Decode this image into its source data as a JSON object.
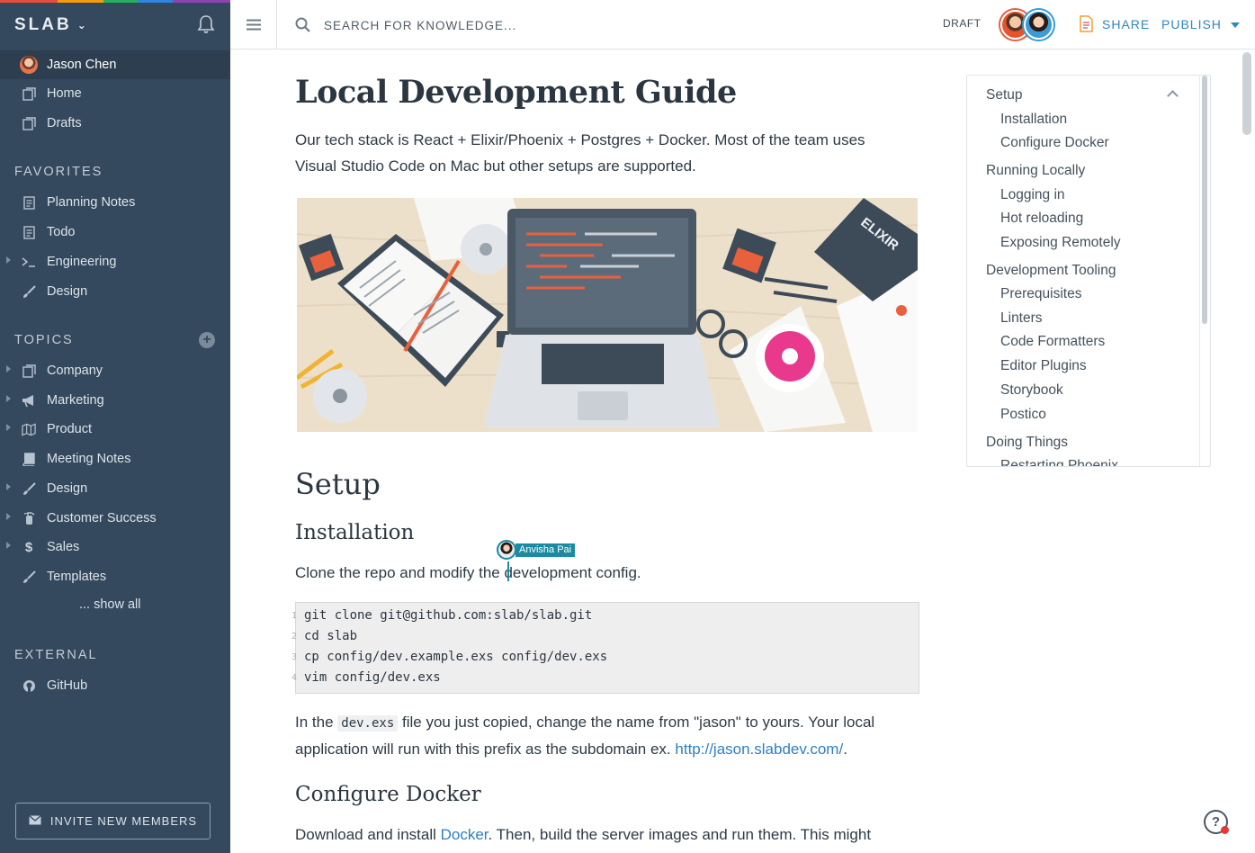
{
  "sidebar": {
    "brand": "SLAB",
    "user": "Jason Chen",
    "top_items": [
      {
        "label": "Home",
        "icon": "pages-icon"
      },
      {
        "label": "Drafts",
        "icon": "pages-icon"
      }
    ],
    "favorites_label": "FAVORITES",
    "favorites": [
      {
        "label": "Planning Notes",
        "icon": "document-icon"
      },
      {
        "label": "Todo",
        "icon": "document-icon"
      },
      {
        "label": "Engineering",
        "icon": "terminal-icon"
      },
      {
        "label": "Design",
        "icon": "brush-icon"
      }
    ],
    "topics_label": "TOPICS",
    "topics": [
      {
        "label": "Company",
        "icon": "pages-icon"
      },
      {
        "label": "Marketing",
        "icon": "megaphone-icon"
      },
      {
        "label": "Product",
        "icon": "map-icon"
      },
      {
        "label": "Meeting Notes",
        "icon": "book-icon"
      },
      {
        "label": "Design",
        "icon": "brush-icon"
      },
      {
        "label": "Customer Success",
        "icon": "extinguisher-icon"
      },
      {
        "label": "Sales",
        "icon": "dollar-icon"
      },
      {
        "label": "Templates",
        "icon": "brush-icon"
      }
    ],
    "show_all": "... show all",
    "external_label": "EXTERNAL",
    "external": [
      {
        "label": "GitHub",
        "icon": "github-icon"
      }
    ],
    "invite_label": "INVITE NEW MEMBERS"
  },
  "topbar": {
    "search_placeholder": "SEARCH FOR KNOWLEDGE...",
    "draft": "DRAFT",
    "share": "SHARE",
    "publish": "PUBLISH"
  },
  "doc": {
    "title": "Local Development Guide",
    "intro_line1": "Our tech stack is React + Elixir/Phoenix + Postgres + Docker. Most of the team uses",
    "intro_line2": "Visual Studio Code on Mac but other setups are supported.",
    "h_setup": "Setup",
    "h_installation": "Installation",
    "install_text": "Clone the repo and modify the development config.",
    "code_lines": [
      "git clone git@github.com:slab/slab.git",
      "cd slab",
      "cp config/dev.example.exs config/dev.exs",
      "vim config/dev.exs"
    ],
    "para2_a": "In the ",
    "para2_code": "dev.exs",
    "para2_b": " file you just copied, change the name from \"jason\" to yours. Your local",
    "para2_c": "application will run with this prefix as the subdomain ex. ",
    "para2_link": "http://jason.slabdev.com/",
    "para2_end": ".",
    "h_docker": "Configure Docker",
    "docker_a": "Download and install ",
    "docker_link": "Docker",
    "docker_b": ". Then, build the server images and run them. This might",
    "collaborator": "Anvisha Pai",
    "hero_book_text": "ELIXIR"
  },
  "toc": [
    {
      "label": "Setup",
      "level": 1
    },
    {
      "label": "Installation",
      "level": 2
    },
    {
      "label": "Configure Docker",
      "level": 2
    },
    {
      "label": "Running Locally",
      "level": 1
    },
    {
      "label": "Logging in",
      "level": 2
    },
    {
      "label": "Hot reloading",
      "level": 2
    },
    {
      "label": "Exposing Remotely",
      "level": 2
    },
    {
      "label": "Development Tooling",
      "level": 1
    },
    {
      "label": "Prerequisites",
      "level": 2
    },
    {
      "label": "Linters",
      "level": 2
    },
    {
      "label": "Code Formatters",
      "level": 2
    },
    {
      "label": "Editor Plugins",
      "level": 2
    },
    {
      "label": "Storybook",
      "level": 2
    },
    {
      "label": "Postico",
      "level": 2
    },
    {
      "label": "Doing Things",
      "level": 1
    },
    {
      "label": "Restarting Phoenix",
      "level": 2
    }
  ],
  "colors": {
    "sidebar": "#34495e",
    "accent": "#2e86c1",
    "collaborator": "#1c8aa0"
  }
}
